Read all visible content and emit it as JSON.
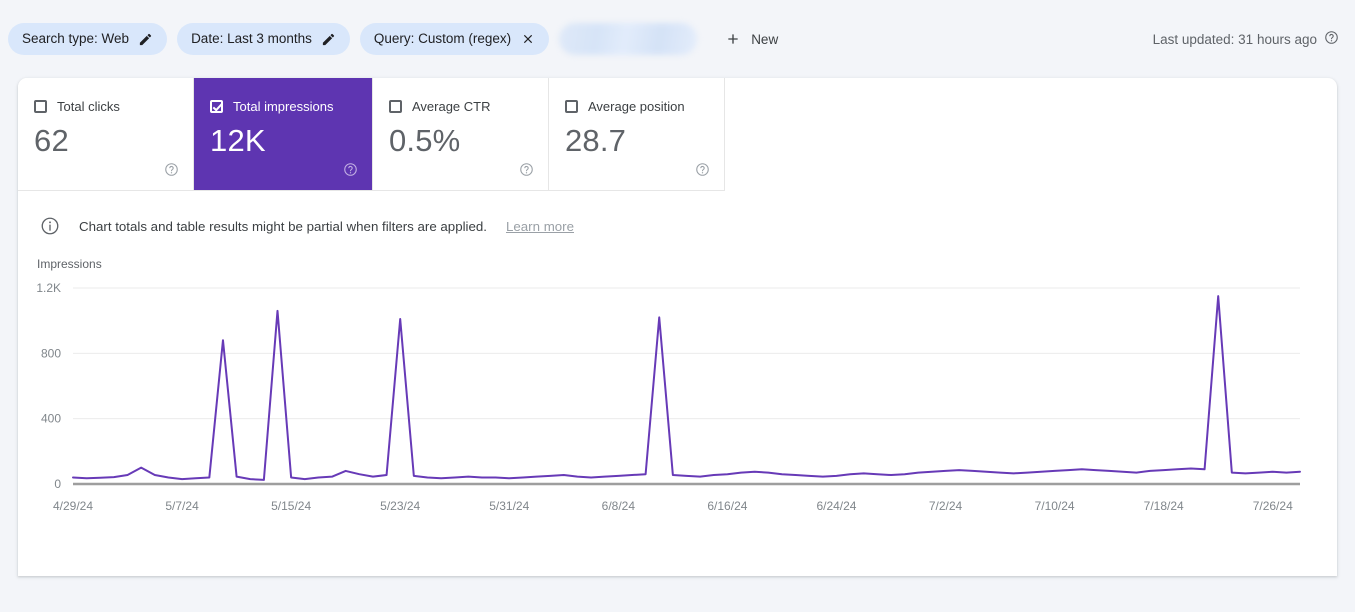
{
  "filter_bar": {
    "chips": [
      {
        "label": "Search type: Web",
        "icon": "pencil-icon",
        "icon_name": "edit-search-type-icon"
      },
      {
        "label": "Date: Last 3 months",
        "icon": "pencil-icon",
        "icon_name": "edit-date-icon"
      },
      {
        "label": "Query: Custom (regex)",
        "icon": "close-icon",
        "icon_name": "remove-query-filter-icon"
      }
    ],
    "redacted_chip": {
      "label": "",
      "blurred": true
    },
    "new_button": {
      "label": "New",
      "icon": "plus-icon"
    },
    "last_updated": {
      "label": "Last updated: 31 hours ago",
      "icon": "help-icon"
    }
  },
  "metrics": [
    {
      "label": "Total clicks",
      "value": "62",
      "selected": false,
      "checkbox": "unchecked",
      "help": "help-icon"
    },
    {
      "label": "Total impressions",
      "value": "12K",
      "selected": true,
      "checkbox": "checked",
      "help": "help-icon"
    },
    {
      "label": "Average CTR",
      "value": "0.5%",
      "selected": false,
      "checkbox": "unchecked",
      "help": "help-icon"
    },
    {
      "label": "Average position",
      "value": "28.7",
      "selected": false,
      "checkbox": "unchecked",
      "help": "help-icon"
    }
  ],
  "banner": {
    "icon": "info-icon",
    "text": "Chart totals and table results might be partial when filters are applied.",
    "link": "Learn more"
  },
  "colors": {
    "accent_purple": "#5e35b1",
    "line_purple": "#673ab7",
    "chip_blue": "#d9e7fb",
    "page_background": "#f3f5f9",
    "text_primary": "#3c4043",
    "text_secondary": "#5f6368"
  },
  "chart_data": {
    "type": "line",
    "title": "Impressions",
    "xlabel": "",
    "ylabel": "Impressions",
    "ylim": [
      0,
      1200
    ],
    "yticks": [
      0,
      400,
      800,
      1200
    ],
    "ytick_labels": [
      "0",
      "400",
      "800",
      "1.2K"
    ],
    "grid": true,
    "legend": "none",
    "series_color": "#673ab7",
    "xtick_labels": [
      "4/29/24",
      "5/7/24",
      "5/15/24",
      "5/23/24",
      "5/31/24",
      "6/8/24",
      "6/16/24",
      "6/24/24",
      "7/2/24",
      "7/10/24",
      "7/18/24",
      "7/26/24"
    ],
    "xtick_indices": [
      0,
      8,
      16,
      24,
      32,
      40,
      48,
      56,
      64,
      72,
      80,
      88
    ],
    "x_start": "4/29/24",
    "x_end": "7/28/24",
    "series": [
      {
        "name": "Impressions",
        "values": [
          40,
          35,
          38,
          42,
          55,
          100,
          55,
          40,
          30,
          35,
          40,
          880,
          45,
          30,
          25,
          1060,
          40,
          30,
          40,
          45,
          80,
          60,
          45,
          55,
          1010,
          50,
          40,
          35,
          40,
          45,
          40,
          40,
          35,
          40,
          45,
          50,
          55,
          45,
          40,
          45,
          50,
          55,
          60,
          1020,
          55,
          50,
          45,
          55,
          60,
          70,
          75,
          70,
          60,
          55,
          50,
          45,
          50,
          60,
          65,
          60,
          55,
          60,
          70,
          75,
          80,
          85,
          80,
          75,
          70,
          65,
          70,
          75,
          80,
          85,
          90,
          85,
          80,
          75,
          70,
          80,
          85,
          90,
          95,
          90,
          1150,
          70,
          65,
          70,
          75,
          70,
          75
        ]
      }
    ]
  }
}
